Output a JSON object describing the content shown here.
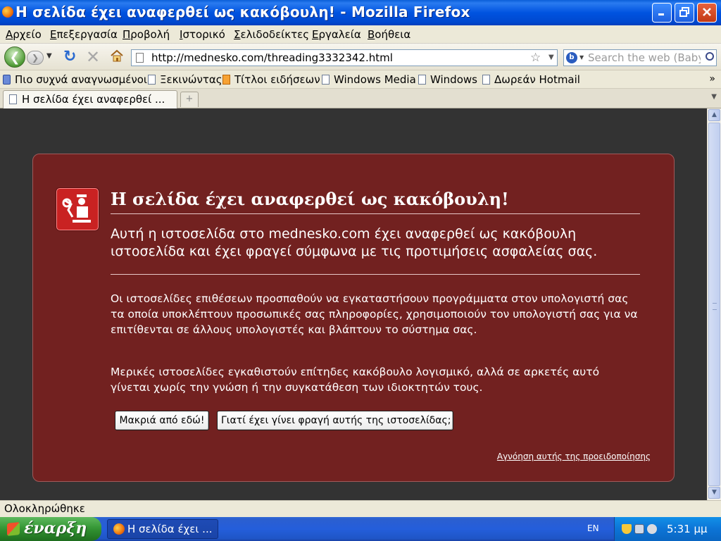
{
  "window": {
    "title": "Η σελίδα έχει αναφερθεί ως κακόβουλη! - Mozilla Firefox",
    "app_icon": "firefox-icon",
    "controls": [
      "minimize-icon",
      "maximize-icon",
      "close-icon"
    ]
  },
  "menu": {
    "items": [
      "Αρχείο",
      "Επεξεργασία",
      "Προβολή",
      "Ιστορικό",
      "Σελιδοδείκτες",
      "Εργαλεία",
      "Βοήθεια"
    ]
  },
  "navbar": {
    "url": "http://mednesko.com/threading3332342.html",
    "search_placeholder": "Search the web (Babylon)",
    "icons": [
      "back-icon",
      "forward-icon",
      "history-dropdown-icon",
      "reload-icon",
      "stop-icon",
      "home-icon",
      "page-icon",
      "star-icon",
      "url-dropdown-icon",
      "search-engine-icon",
      "magnifier-icon"
    ]
  },
  "bookmarks": {
    "items": [
      {
        "label": "Πιο συχνά αναγνωσμένοι",
        "icon": "smart-folder-icon"
      },
      {
        "label": "Ξεκινώντας",
        "icon": "page-icon"
      },
      {
        "label": "Τίτλοι ειδήσεων",
        "icon": "rss-icon"
      },
      {
        "label": "Windows Media",
        "icon": "page-icon"
      },
      {
        "label": "Windows",
        "icon": "page-icon"
      },
      {
        "label": "Δωρεάν Hotmail",
        "icon": "page-icon"
      }
    ],
    "overflow": "»"
  },
  "tabs": {
    "active_label": "Η σελίδα έχει αναφερθεί ...",
    "new_tab": "+"
  },
  "warning": {
    "title": "Η σελίδα έχει αναφερθεί ως κακόβουλη!",
    "short_desc": "Αυτή η ιστοσελίδα στο  mednesko.com έχει αναφερθεί ως κακόβουλη ιστοσελίδα και έχει φραγεί σύμφωνα με τις προτιμήσεις ασφαλείας σας.",
    "long_desc_1": "Οι ιστοσελίδες επιθέσεων προσπαθούν να εγκαταστήσουν προγράμματα στον υπολογιστή σας τα οποία υποκλέπτουν προσωπικές σας πληροφορίες, χρησιμοποιούν τον υπολογιστή σας για να επιτίθενται σε άλλους υπολογιστές και βλάπτουν το σύστημα σας.",
    "long_desc_2": "Μερικές ιστοσελίδες εγκαθιστούν επίτηδες κακόβουλο λογισμικό, αλλά σε αρκετές αυτό γίνεται χωρίς την γνώση ή την συγκατάθεση των ιδιοκτητών τους.",
    "get_me_out_button": "Μακριά από εδώ!",
    "why_blocked_button": "Γιατί έχει γίνει φραγή αυτής της ιστοσελίδας;",
    "ignore_link": "Αγνόηση αυτής της προειδοποίησης",
    "icon": "guard-shield-icon"
  },
  "status": {
    "text": "Ολοκληρώθηκε"
  },
  "taskbar": {
    "start_label": "έναρξη",
    "task_label": "Η σελίδα έχει ...",
    "language": "EN",
    "clock": "5:31 μμ"
  },
  "colors": {
    "panel_background": "#722120",
    "page_background": "#333333",
    "title_bar": "#0053e0",
    "taskbar": "#245edb",
    "start_button": "#3a9b3a"
  }
}
